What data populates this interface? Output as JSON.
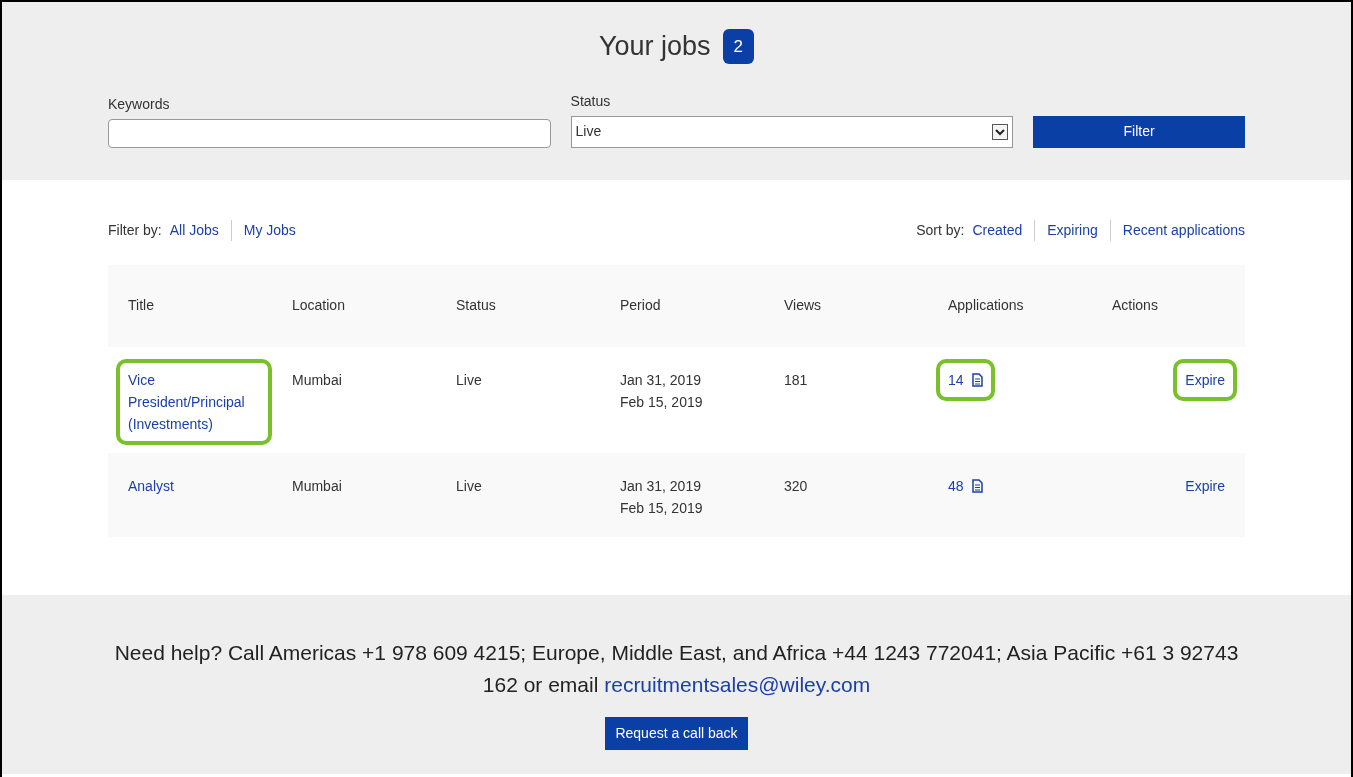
{
  "header": {
    "title": "Your jobs",
    "count": "2"
  },
  "filters": {
    "keywords": {
      "label": "Keywords"
    },
    "status": {
      "label": "Status",
      "value": "Live"
    },
    "button": "Filter"
  },
  "filter_by": {
    "label": "Filter by:",
    "links": [
      "All Jobs",
      "My Jobs"
    ]
  },
  "sort_by": {
    "label": "Sort by:",
    "links": [
      "Created",
      "Expiring",
      "Recent applications"
    ]
  },
  "table": {
    "columns": [
      "Title",
      "Location",
      "Status",
      "Period",
      "Views",
      "Applications",
      "Actions"
    ],
    "rows": [
      {
        "title": "Vice President/Principal (Investments)",
        "title_highlighted": true,
        "location": "Mumbai",
        "status": "Live",
        "period_start": "Jan 31, 2019",
        "period_end": "Feb 15, 2019",
        "views": "181",
        "applications": "14",
        "applications_highlighted": true,
        "action": "Expire",
        "action_highlighted": true
      },
      {
        "title": "Analyst",
        "title_highlighted": false,
        "location": "Mumbai",
        "status": "Live",
        "period_start": "Jan 31, 2019",
        "period_end": "Feb 15, 2019",
        "views": "320",
        "applications": "48",
        "applications_highlighted": false,
        "action": "Expire",
        "action_highlighted": false
      }
    ]
  },
  "footer": {
    "help_text": "Need help? Call Americas +1 978 609 4215; Europe, Middle East, and Africa +44 1243 772041; Asia Pacific +61 3 92743 162 or email",
    "email": "recruitmentsales@wiley.com",
    "button": "Request a call back"
  }
}
